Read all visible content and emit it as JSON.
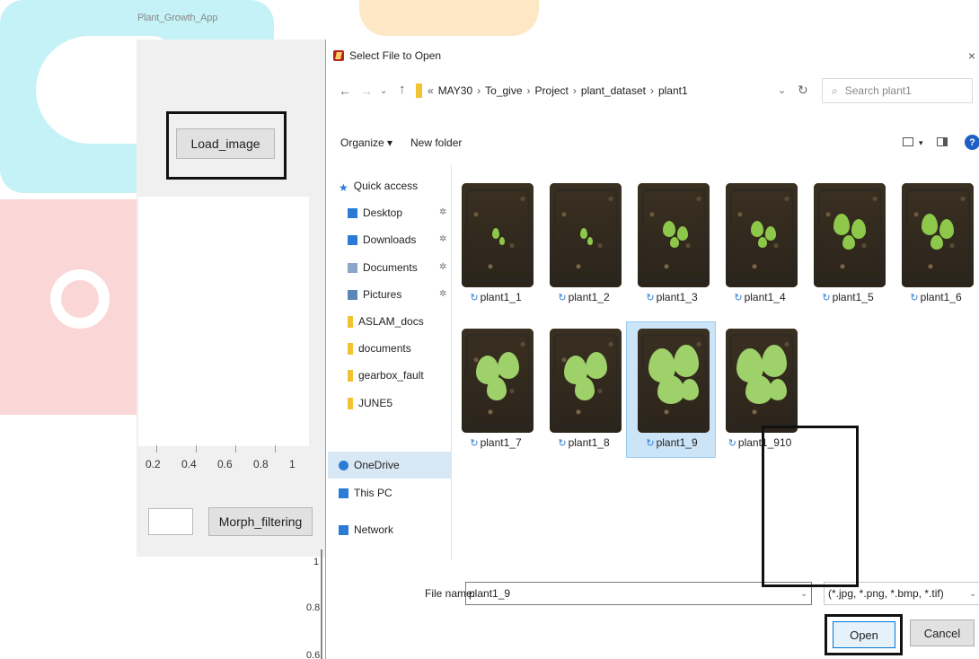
{
  "app": {
    "title": "Plant_Growth_App",
    "load_button": "Load_image",
    "morph_button": "Morph_filtering",
    "x_ticks": [
      "0.2",
      "0.4",
      "0.6",
      "0.8",
      "1"
    ],
    "y_ticks": [
      "1",
      "0.8",
      "0.6"
    ]
  },
  "dialog": {
    "title": "Select File to Open",
    "close_glyph": "×",
    "path": [
      "MAY30",
      "To_give",
      "Project",
      "plant_dataset",
      "plant1"
    ],
    "path_overflow": "«",
    "search_placeholder": "Search plant1",
    "organize_label": "Organize ▾",
    "new_folder_label": "New folder",
    "sidebar": [
      {
        "label": "Quick access",
        "icon": "star-icon",
        "color": "#2b7bd6",
        "pinned": false
      },
      {
        "label": "Desktop",
        "icon": "desktop-icon",
        "color": "#2b7bd6",
        "pinned": true
      },
      {
        "label": "Downloads",
        "icon": "download-icon",
        "color": "#2b7bd6",
        "pinned": true
      },
      {
        "label": "Documents",
        "icon": "documents-icon",
        "color": "#8aa7c9",
        "pinned": true
      },
      {
        "label": "Pictures",
        "icon": "pictures-icon",
        "color": "#5a86b8",
        "pinned": true
      },
      {
        "label": "ASLAM_docs",
        "icon": "folder-icon",
        "color": "#f1c232",
        "pinned": false
      },
      {
        "label": "documents",
        "icon": "folder-icon",
        "color": "#f1c232",
        "pinned": false
      },
      {
        "label": "gearbox_fault",
        "icon": "folder-icon",
        "color": "#f1c232",
        "pinned": false
      },
      {
        "label": "JUNE5",
        "icon": "folder-icon",
        "color": "#f1c232",
        "pinned": false
      },
      {
        "label": "OneDrive",
        "icon": "cloud-icon",
        "color": "#2b7bd6",
        "pinned": false
      },
      {
        "label": "This PC",
        "icon": "computer-icon",
        "color": "#2b7bd6",
        "pinned": false
      },
      {
        "label": "Network",
        "icon": "network-icon",
        "color": "#2b7bd6",
        "pinned": false
      }
    ],
    "pin_glyph": "✲",
    "sync_glyph": "↻",
    "files": [
      {
        "name": "plant1_1",
        "leaf_size": 1
      },
      {
        "name": "plant1_2",
        "leaf_size": 1
      },
      {
        "name": "plant1_3",
        "leaf_size": 2
      },
      {
        "name": "plant1_4",
        "leaf_size": 2
      },
      {
        "name": "plant1_5",
        "leaf_size": 3
      },
      {
        "name": "plant1_6",
        "leaf_size": 3
      },
      {
        "name": "plant1_7",
        "leaf_size": 4
      },
      {
        "name": "plant1_8",
        "leaf_size": 4
      },
      {
        "name": "plant1_9",
        "leaf_size": 5,
        "selected": true
      },
      {
        "name": "plant1_910",
        "leaf_size": 5
      }
    ],
    "file_name_label": "File name:",
    "file_name_value": "plant1_9",
    "filter_value": "(*.jpg, *.png, *.bmp, *.tif)",
    "open_label": "Open",
    "cancel_label": "Cancel"
  }
}
